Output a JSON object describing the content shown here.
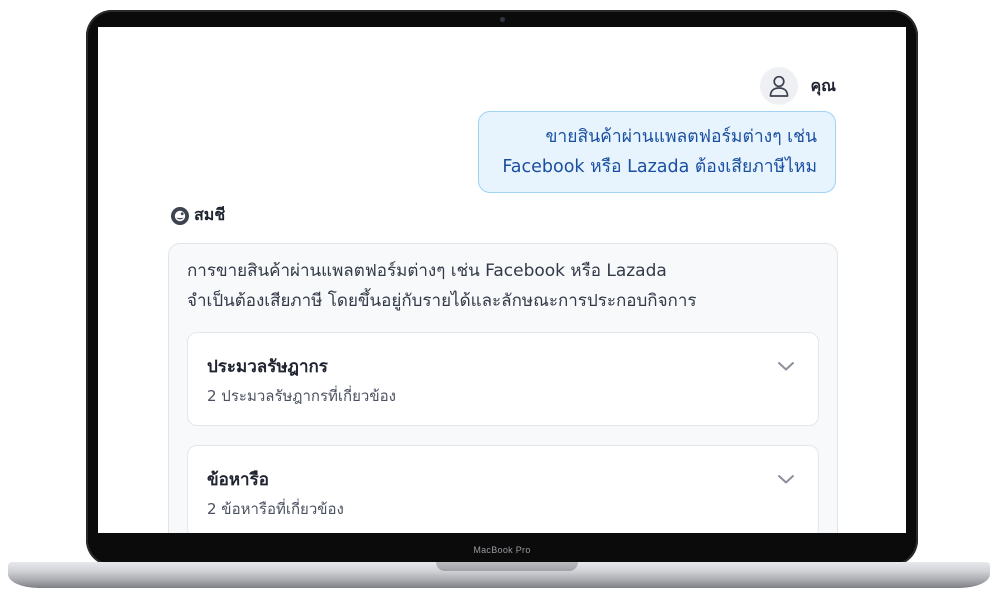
{
  "device": {
    "model_label": "MacBook Pro"
  },
  "chat": {
    "user": {
      "name": "คุณ",
      "avatar_icon": "user-icon",
      "message_line1": "ขายสินค้าผ่านแพลตฟอร์มต่างๆ เช่น",
      "message_line2": "Facebook หรือ Lazada ต้องเสียภาษีไหม"
    },
    "assistant": {
      "name": "สมชี",
      "logo_icon": "assistant-logo-icon",
      "answer_line1": "การขายสินค้าผ่านแพลตฟอร์มต่างๆ เช่น Facebook หรือ Lazada",
      "answer_line2": "จำเป็นต้องเสียภาษี โดยขึ้นอยู่กับรายได้และลักษณะการประกอบกิจการ",
      "sections": [
        {
          "title": "ประมวลรัษฎากร",
          "subtitle": "2 ประมวลรัษฎากรที่เกี่ยวข้อง",
          "icon": "chevron-down-icon"
        },
        {
          "title": "ข้อหารือ",
          "subtitle": "2 ข้อหารือที่เกี่ยวข้อง",
          "icon": "chevron-down-icon"
        }
      ]
    }
  },
  "colors": {
    "user_bubble_bg": "#e7f4fd",
    "user_bubble_border": "#9fd3f2",
    "user_text": "#1b4fa0",
    "answer_bg": "#f7f9fb"
  }
}
